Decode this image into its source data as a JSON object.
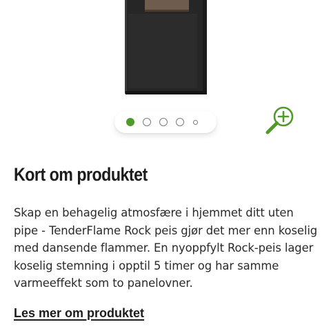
{
  "product_gallery": {
    "slide_count": 5,
    "active_slide": 1
  },
  "info": {
    "title": "Kort om produktet",
    "description": "Skap en behagelig atmosfære i hjemmet ditt uten pipe - TenderFlame Rock peis gjør det mer enn koselig med dansende flammer. En nyoppfylt Rock-peis lager koselig stemning i opptil 5 timer og har samme varmeeffekt som to panelovner.",
    "read_more_link": "Les mer om produktet"
  },
  "colors": {
    "accent": "#4f9a2a",
    "text": "#1c1c1c"
  },
  "icons": {
    "zoom": "zoom-in-icon"
  }
}
